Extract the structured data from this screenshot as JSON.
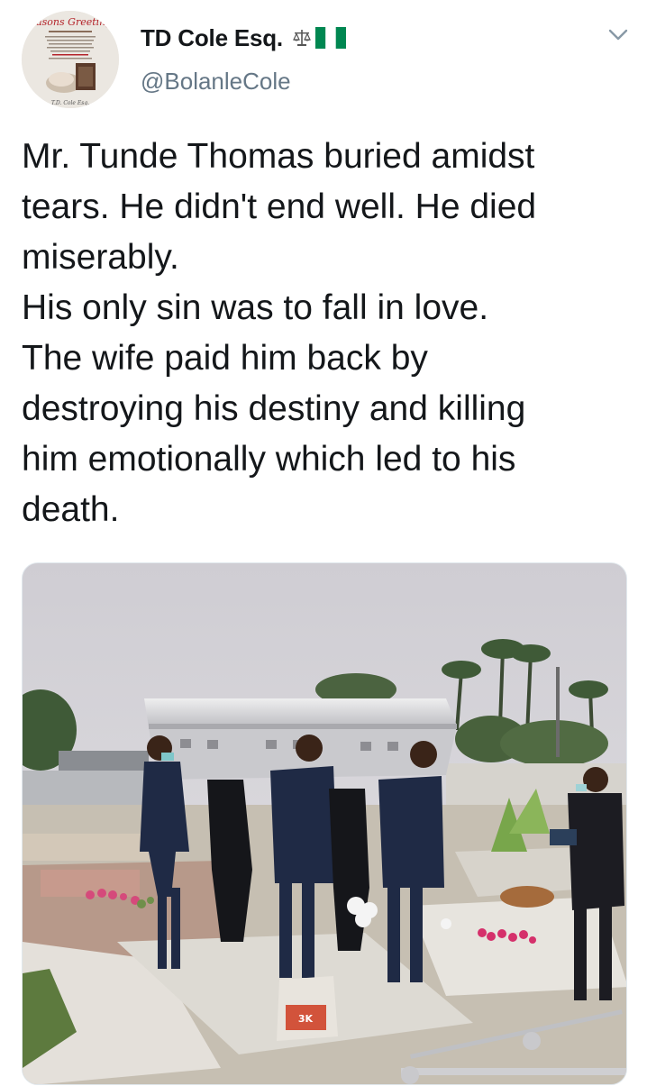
{
  "author": {
    "display_name": "TD Cole Esq.",
    "handle": "@BolanleCole",
    "badges": [
      "scales-icon",
      "nigeria-flag-icon"
    ],
    "avatar_caption": "Seasons Greetings",
    "avatar_signature": "T.D. Cole Esq."
  },
  "tweet": {
    "lines": [
      "Mr. Tunde Thomas buried amidst",
      "tears. He didn't end well. He died",
      "miserably.",
      "His only sin was to fall in love.",
      "The wife paid him back by",
      "destroying his destiny and killing",
      "him emotionally which led to his",
      "death."
    ]
  },
  "media": {
    "kind": "photo",
    "bag_label": "3K"
  },
  "colors": {
    "text": "#14171a",
    "secondary": "#657786",
    "flag_green": "#008751"
  }
}
